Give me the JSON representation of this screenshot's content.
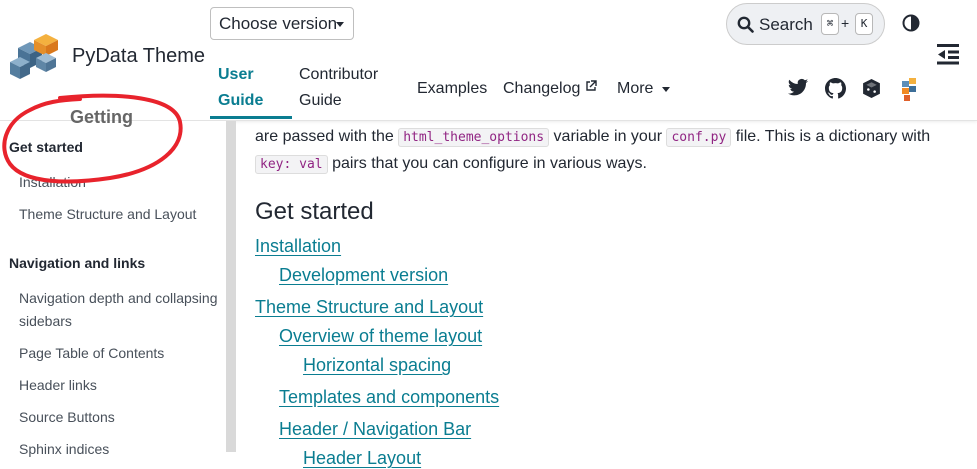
{
  "header": {
    "brand": "PyData Theme",
    "version_button": "Choose version",
    "search": {
      "label": "Search",
      "key1": "⌘",
      "plus": "+",
      "key2": "K"
    },
    "nav": [
      {
        "line1": "User",
        "line2": "Guide",
        "active": true
      },
      {
        "line1": "Contributor",
        "line2": "Guide",
        "active": false
      },
      {
        "label": "Examples"
      },
      {
        "label": "Changelog"
      },
      {
        "label": "More"
      }
    ],
    "icons": [
      "twitter-icon",
      "github-icon",
      "pypi-icon",
      "pydata-icon",
      "theme-toggle-icon",
      "toc-toggle-icon",
      "search-icon",
      "external-link-icon"
    ],
    "colors": {
      "accent": "#0a7d91",
      "code": "#912583",
      "annotation": "#e8232c"
    }
  },
  "sidebar": {
    "partial_heading": "Getting",
    "sections": [
      {
        "heading": "Get started",
        "items": [
          "Installation",
          "Theme Structure and Layout"
        ]
      },
      {
        "heading": "Navigation and links",
        "items": [
          "Navigation depth and collapsing sidebars",
          "Page Table of Contents",
          "Header links",
          "Source Buttons",
          "Sphinx indices"
        ]
      }
    ]
  },
  "main": {
    "para": {
      "t1": "are passed with the ",
      "c1": "html_theme_options",
      "t2": " variable in your ",
      "c2": "conf.py",
      "t3": " file. This is a dictionary with ",
      "c3": "key: val",
      "t4": " pairs that you can configure in various ways."
    },
    "heading": "Get started",
    "toc": [
      {
        "label": "Installation",
        "level": 1
      },
      {
        "label": "Development version",
        "level": 2
      },
      {
        "label": "Theme Structure and Layout",
        "level": 1
      },
      {
        "label": "Overview of theme layout",
        "level": 2
      },
      {
        "label": "Horizontal spacing",
        "level": 3
      },
      {
        "label": "Templates and components",
        "level": 2
      },
      {
        "label": "Header / Navigation Bar",
        "level": 2
      },
      {
        "label": "Header Layout",
        "level": 3
      }
    ]
  }
}
